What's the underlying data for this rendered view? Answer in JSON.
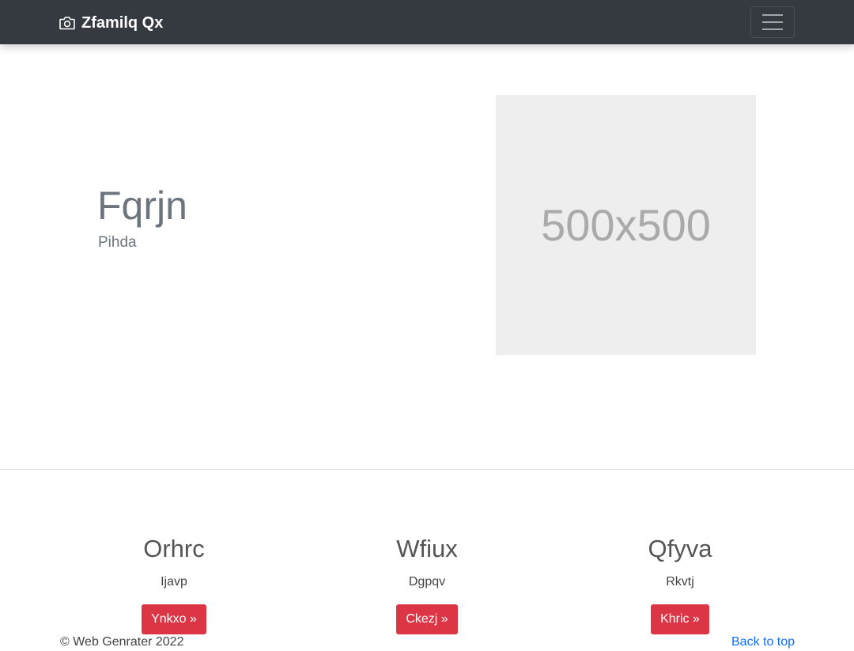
{
  "navbar": {
    "brand": "Zfamilq Qx",
    "brand_icon": "camera-icon",
    "toggler_icon": "hamburger-menu-icon"
  },
  "hero": {
    "title": "Fqrjn",
    "subtitle": "Pihda",
    "image_placeholder": "500x500"
  },
  "features": [
    {
      "title": "Orhrc",
      "text": "Ijavp",
      "button": "Ynkxo »"
    },
    {
      "title": "Wfiux",
      "text": "Dgpqv",
      "button": "Ckezj »"
    },
    {
      "title": "Qfyva",
      "text": "Rkvtj",
      "button": "Khric »"
    }
  ],
  "footer": {
    "copyright": "© Web Genrater 2022",
    "back_to_top": "Back to top"
  },
  "colors": {
    "navbar_bg": "#343a40",
    "button_bg": "#dc3545",
    "link": "#0d6efd"
  }
}
